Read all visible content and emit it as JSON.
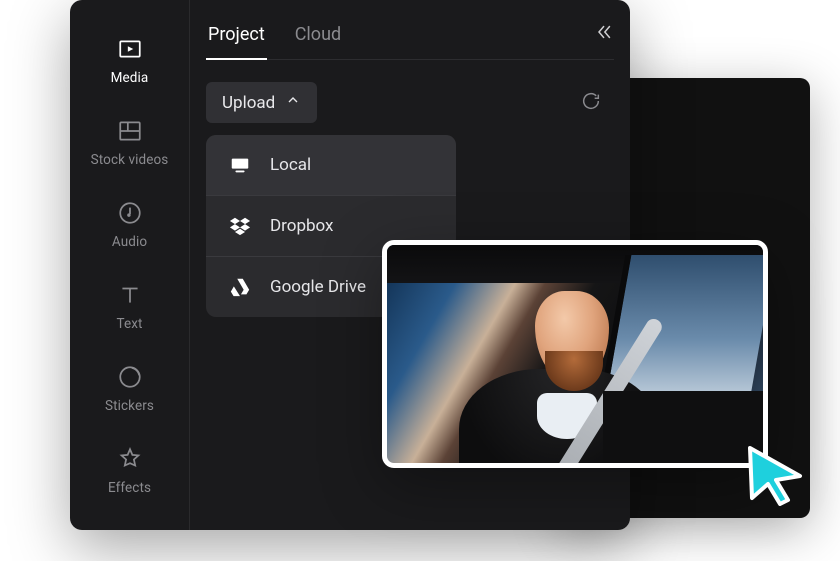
{
  "sidebar": {
    "items": [
      {
        "label": "Media"
      },
      {
        "label": "Stock videos"
      },
      {
        "label": "Audio"
      },
      {
        "label": "Text"
      },
      {
        "label": "Stickers"
      },
      {
        "label": "Effects"
      }
    ]
  },
  "tabs": [
    {
      "label": "Project"
    },
    {
      "label": "Cloud"
    }
  ],
  "toolbar": {
    "upload_label": "Upload"
  },
  "upload_menu": {
    "items": [
      {
        "label": "Local",
        "icon": "monitor-icon"
      },
      {
        "label": "Dropbox",
        "icon": "dropbox-icon"
      },
      {
        "label": "Google Drive",
        "icon": "google-drive-icon"
      }
    ]
  },
  "colors": {
    "cursor": "#1ed0dd",
    "panel_bg": "#1a1a1c",
    "card_bg": "#2b2b2e"
  }
}
